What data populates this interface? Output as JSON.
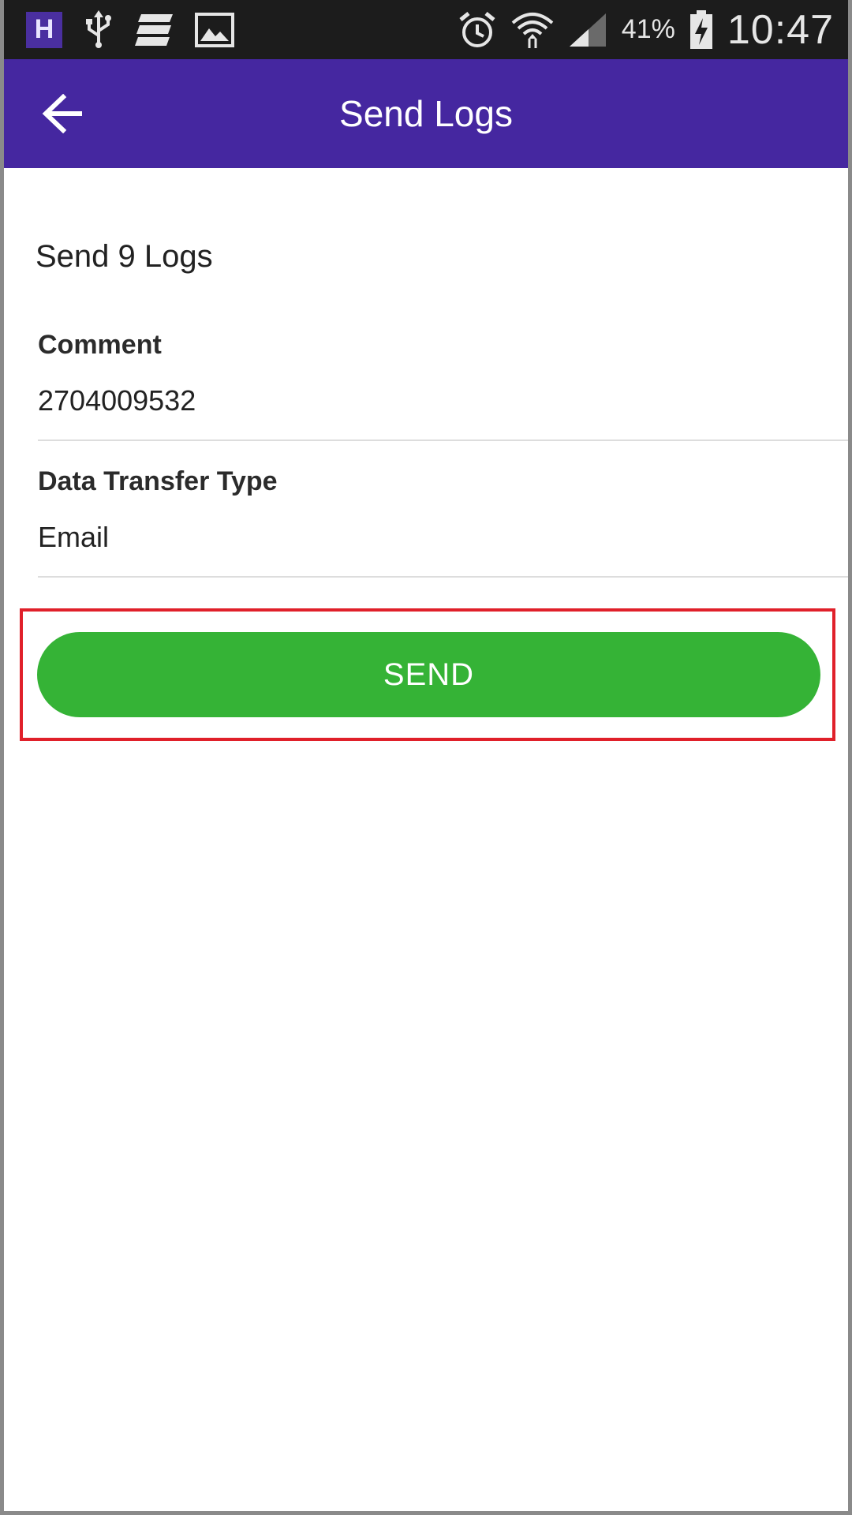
{
  "status_bar": {
    "badge_letter": "H",
    "battery_percent": "41%",
    "time": "10:47",
    "icons": [
      "h-app-icon",
      "usb-icon",
      "stacked-bars-icon",
      "image-icon",
      "alarm-icon",
      "wifi-icon",
      "signal-icon",
      "battery-charging-icon"
    ]
  },
  "app_bar": {
    "title": "Send Logs",
    "back_icon": "arrow-left-icon",
    "color": "#4527a0"
  },
  "main": {
    "heading": "Send 9 Logs",
    "comment": {
      "label": "Comment",
      "value": "2704009532"
    },
    "transfer_type": {
      "label": "Data Transfer Type",
      "value": "Email"
    },
    "send_button": {
      "label": "SEND",
      "color": "#35b336"
    },
    "highlight_color": "#e0202a"
  }
}
